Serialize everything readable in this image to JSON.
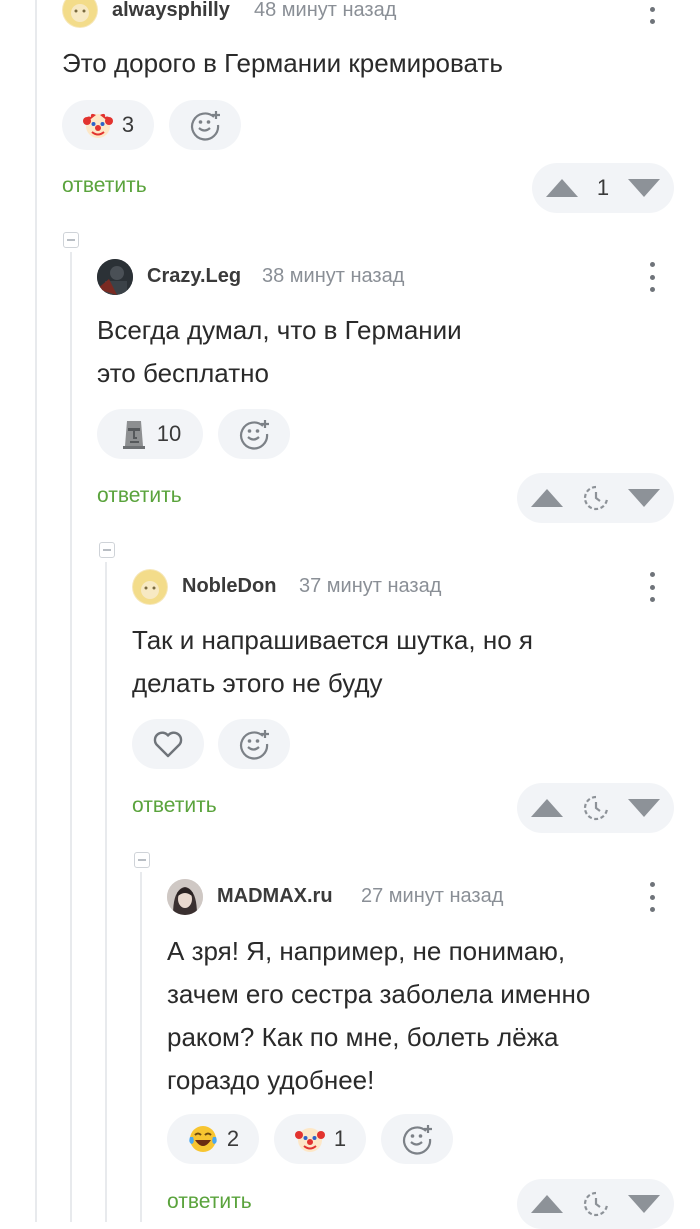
{
  "comments": [
    {
      "username": "alwaysphilly",
      "time": "48 минут назад",
      "text": "Это дорого в Германии кремировать",
      "reactions": [
        {
          "icon": "clown-emoji",
          "count": "3"
        }
      ],
      "reply_label": "ответить",
      "vote_rating": "1"
    },
    {
      "username": "Crazy.Leg",
      "time": "38 минут назад",
      "text_lines": [
        "Всегда думал, что в Германии",
        "это бесплатно"
      ],
      "reactions": [
        {
          "icon": "moai-emoji",
          "count": "10"
        }
      ],
      "reply_label": "ответить",
      "vote_rating_icon": "clock-icon"
    },
    {
      "username": "NobleDon",
      "time": "37 минут назад",
      "text_lines": [
        "Так и напрашивается шутка, но я",
        "делать этого не буду"
      ],
      "reactions": [
        {
          "icon": "heart-icon",
          "count": ""
        }
      ],
      "reply_label": "ответить",
      "vote_rating_icon": "clock-icon"
    },
    {
      "username": "MADMAX.ru",
      "time": "27 минут назад",
      "text_lines": [
        "А зря! Я, например, не понимаю,",
        "зачем его сестра заболела именно",
        "раком? Как по мне, болеть лёжа",
        "гораздо удобнее!"
      ],
      "reactions": [
        {
          "icon": "laughing-tears-emoji",
          "count": "2"
        },
        {
          "icon": "clown-emoji",
          "count": "1"
        }
      ],
      "reply_label": "ответить",
      "vote_rating_icon": "clock-icon"
    }
  ],
  "colors": {
    "reply": "#5aa33c",
    "pill_bg": "#f2f4f7",
    "thread_line": "#e8eaed",
    "arrow": "#8d9298"
  }
}
